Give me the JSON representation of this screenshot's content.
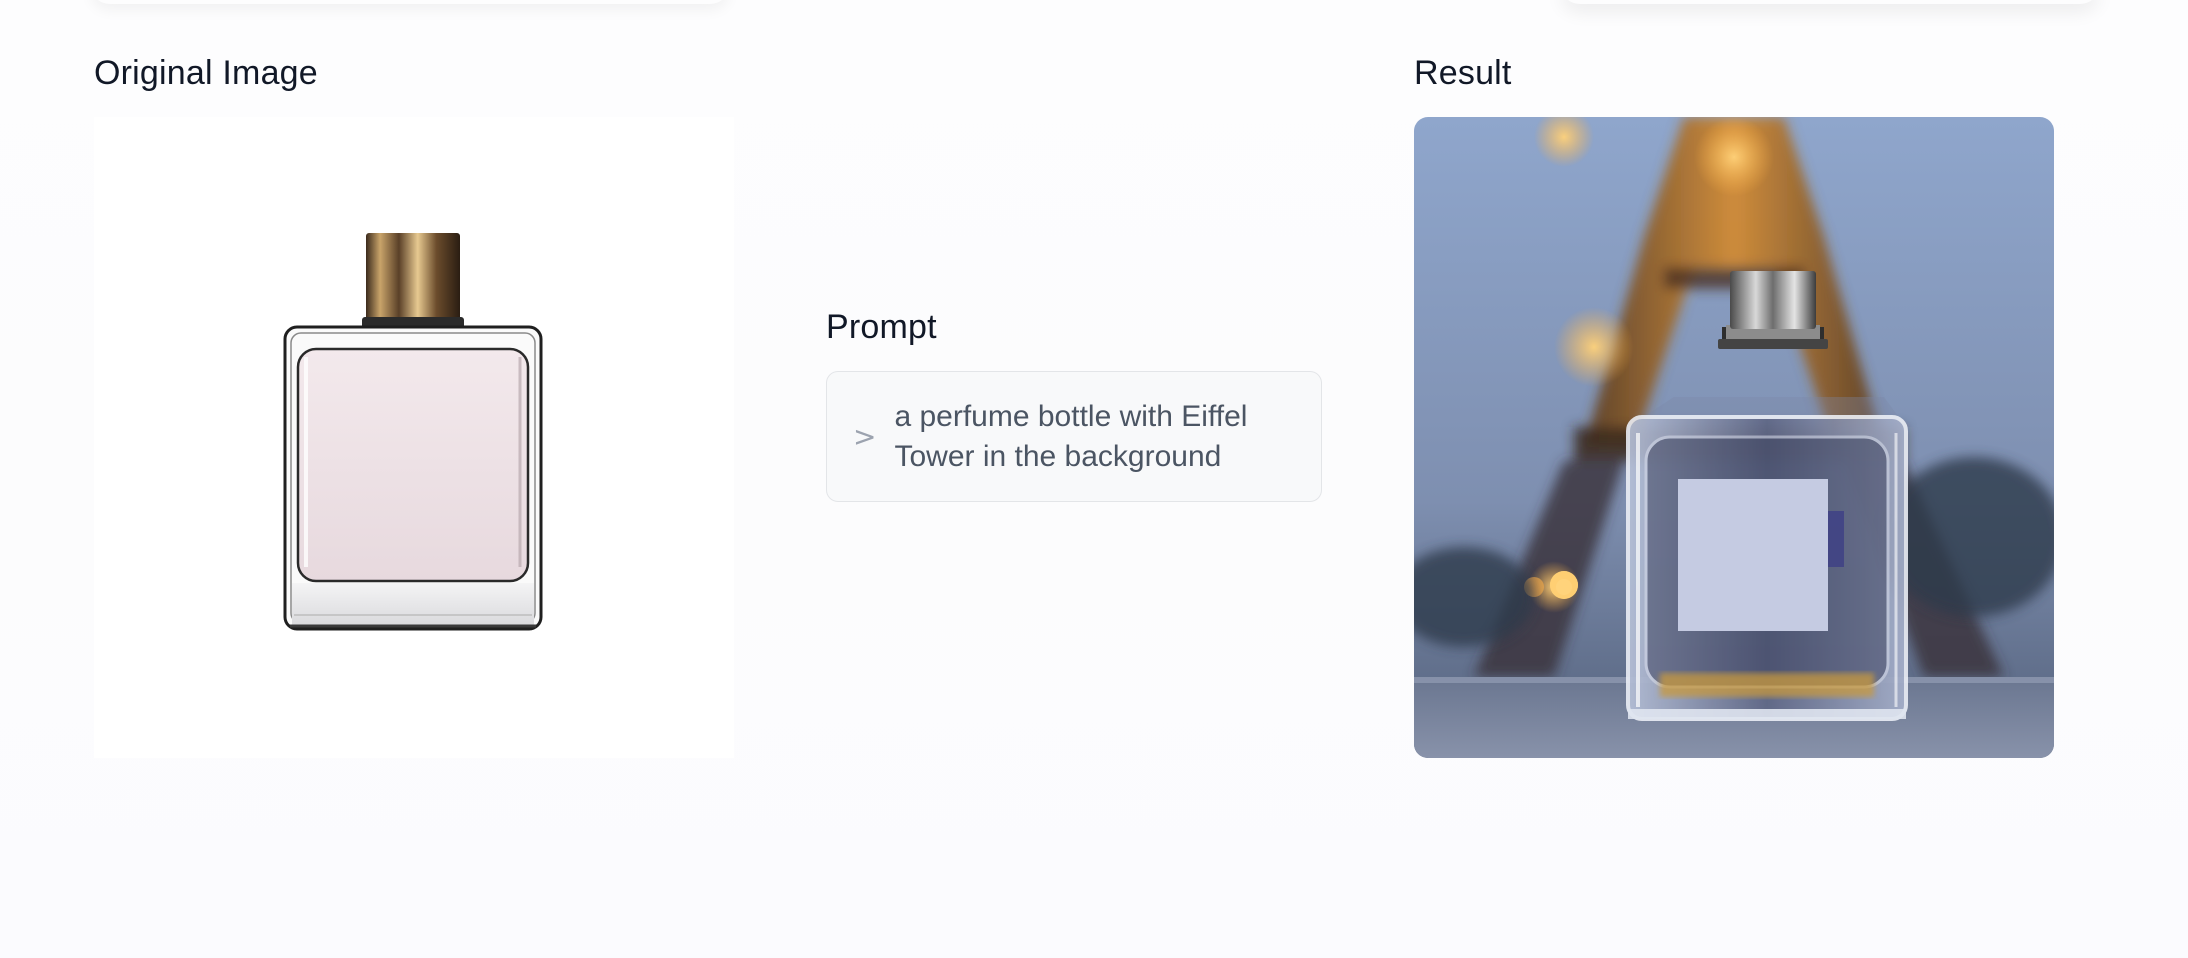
{
  "sections": {
    "original_title": "Original Image",
    "prompt_title": "Prompt",
    "result_title": "Result"
  },
  "prompt": {
    "chevron": ">",
    "text": "a perfume bottle with Eiffel Tower in the background"
  },
  "colors": {
    "title": "#111827",
    "prompt_text": "#4b5563",
    "prompt_bg": "#f8f9fa",
    "prompt_border": "#e3e5e8"
  },
  "icons": {
    "prompt_chevron": "chevron-right-icon"
  }
}
